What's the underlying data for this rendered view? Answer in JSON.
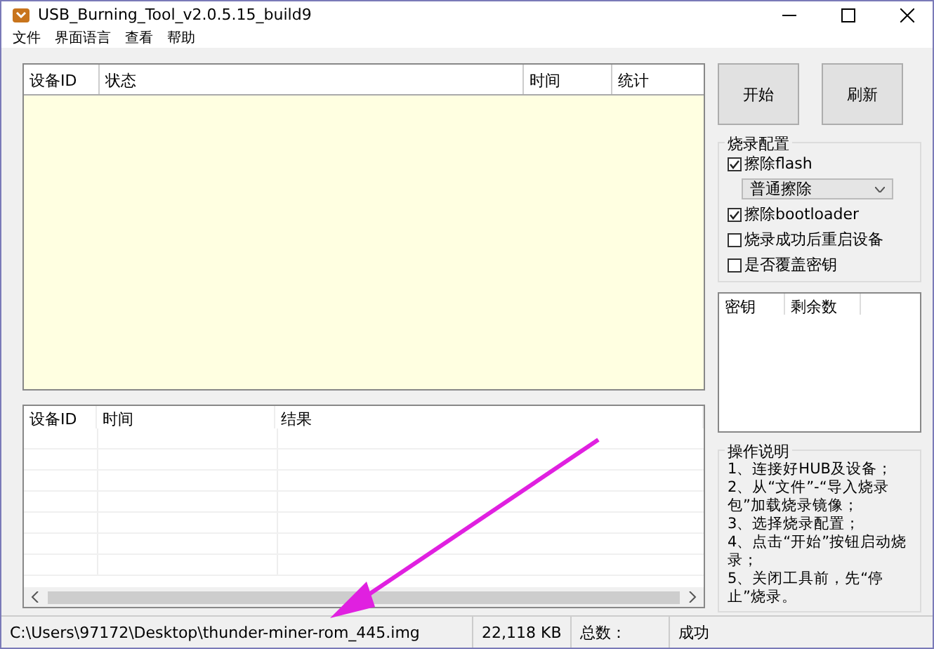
{
  "window": {
    "title": "USB_Burning_Tool_v2.0.5.15_build9"
  },
  "menu": [
    "文件",
    "界面语言",
    "查看",
    "帮助"
  ],
  "device_table": {
    "columns": [
      "设备ID",
      "状态",
      "时间",
      "统计"
    ]
  },
  "buttons": [
    "开始",
    "刷新"
  ],
  "burn_config": {
    "title": "烧录配置",
    "options": [
      {
        "kind": "checkbox",
        "label": "擦除flash",
        "checked": true
      },
      {
        "kind": "dropdown",
        "value": "普通擦除"
      },
      {
        "kind": "checkbox",
        "label": "擦除bootloader",
        "checked": true
      },
      {
        "kind": "checkbox",
        "label": "烧录成功后重启设备",
        "checked": false
      },
      {
        "kind": "checkbox",
        "label": "是否覆盖密钥",
        "checked": false
      }
    ]
  },
  "key_table": {
    "columns": [
      "密钥",
      "剩余数"
    ]
  },
  "log_table": {
    "columns": [
      "设备ID",
      "时间",
      "结果"
    ]
  },
  "instructions": {
    "title": "操作说明",
    "lines": [
      "1、连接好HUB及设备；",
      "2、从“文件”-“导入烧录包”加载烧录镜像；",
      "3、选择烧录配置；",
      "4、点击“开始”按钮启动烧录；",
      "5、关闭工具前，先“停止”烧录。"
    ]
  },
  "status_bar": {
    "path": "C:\\Users\\97172\\Desktop\\thunder-miner-rom_445.img",
    "size": "22,118 KB",
    "total_label": "总数：",
    "success_label": "成功"
  }
}
